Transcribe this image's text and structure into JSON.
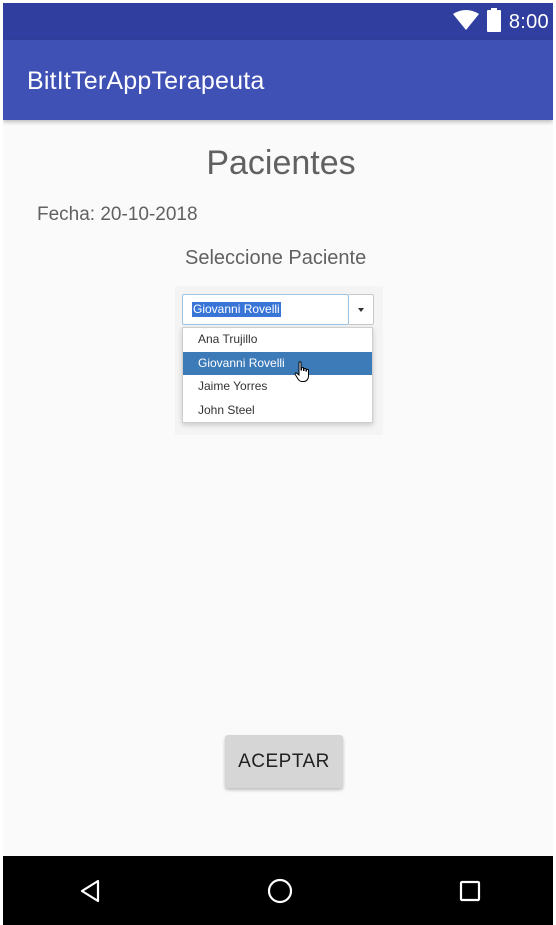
{
  "status_bar": {
    "time": "8:00",
    "icons": [
      "wifi-icon",
      "battery-icon"
    ]
  },
  "app_bar": {
    "title": "BitItTerAppTerapeuta",
    "color": "#3f51b5",
    "status_color": "#303f9f"
  },
  "main": {
    "heading": "Pacientes",
    "date_text": "Fecha: 20-10-2018",
    "select_label": "Seleccione Paciente",
    "select": {
      "selected_value": "Giovanni Rovelli",
      "options": [
        "Ana Trujillo",
        "Giovanni Rovelli",
        "Jaime Yorres",
        "John Steel"
      ],
      "highlighted_option": "Giovanni Rovelli",
      "highlight_color": "#3c7ab8"
    },
    "accept_label": "ACEPTAR"
  },
  "nav_bar": {
    "icons": [
      "back-icon",
      "home-icon",
      "recents-icon"
    ]
  }
}
